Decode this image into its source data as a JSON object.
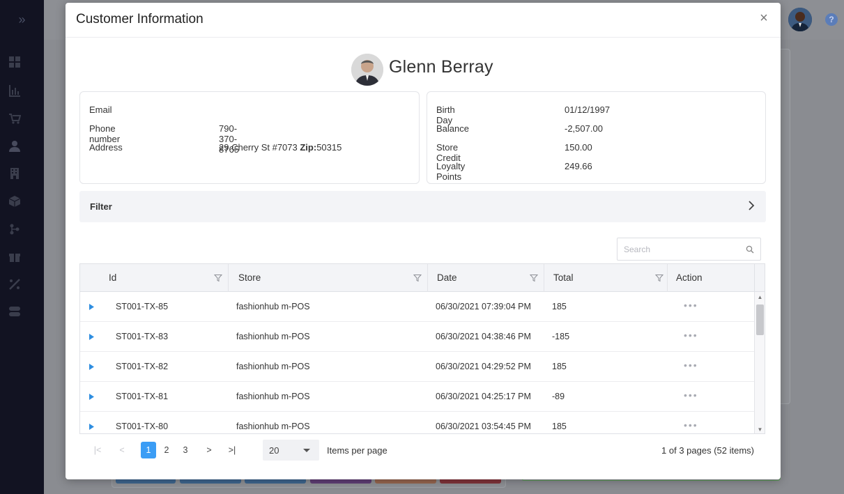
{
  "modal": {
    "title": "Customer Information",
    "close_glyph": "×"
  },
  "customer": {
    "name": "Glenn Berray",
    "left_fields": [
      {
        "label": "Email",
        "value": ""
      },
      {
        "label": "Phone number",
        "value": "790-370-8765"
      },
      {
        "label": "Address",
        "value": "29 Cherry St #7073",
        "zip_label": "Zip:",
        "zip_value": "50315"
      }
    ],
    "right_fields": [
      {
        "label": "Birth Day",
        "value": "01/12/1997"
      },
      {
        "label": "Balance",
        "value": "-2,507.00"
      },
      {
        "label": "Store Credit",
        "value": "150.00"
      },
      {
        "label": "Loyalty Points",
        "value": "249.66"
      }
    ]
  },
  "filter": {
    "label": "Filter"
  },
  "search": {
    "placeholder": "Search",
    "value": ""
  },
  "grid": {
    "columns": [
      "Id",
      "Store",
      "Date",
      "Total",
      "Action"
    ],
    "rows": [
      {
        "id": "ST001-TX-85",
        "store": "fashionhub m-POS",
        "date": "06/30/2021 07:39:04 PM",
        "total": "185",
        "action": "•••"
      },
      {
        "id": "ST001-TX-83",
        "store": "fashionhub m-POS",
        "date": "06/30/2021 04:38:46 PM",
        "total": "-185",
        "action": "•••"
      },
      {
        "id": "ST001-TX-82",
        "store": "fashionhub m-POS",
        "date": "06/30/2021 04:29:52 PM",
        "total": "185",
        "action": "•••"
      },
      {
        "id": "ST001-TX-81",
        "store": "fashionhub m-POS",
        "date": "06/30/2021 04:25:17 PM",
        "total": "-89",
        "action": "•••"
      },
      {
        "id": "ST001-TX-80",
        "store": "fashionhub m-POS",
        "date": "06/30/2021 03:54:45 PM",
        "total": "185",
        "action": "•••"
      }
    ]
  },
  "pager": {
    "first": "|<",
    "prev": "<",
    "pages": [
      "1",
      "2",
      "3"
    ],
    "current_page": "1",
    "next": ">",
    "last": ">|",
    "page_size": "20",
    "items_per_page_label": "Items per page",
    "info": "1 of 3 pages (52 items)"
  },
  "colors": {
    "accent": "#3b9df5",
    "sidebar": "#121322",
    "overlay": "#8a8c91"
  },
  "icons": {
    "rail": [
      "dashboard-icon",
      "chart-icon",
      "cart-icon",
      "user-icon",
      "building-icon",
      "box-icon",
      "hierarchy-icon",
      "gift-icon",
      "tag-icon",
      "toggle-icon"
    ],
    "header": [
      "close-icon"
    ],
    "filter": "chevron-right-icon",
    "search": "search-icon",
    "column": "filter-funnel-icon",
    "row": "expand-caret-icon"
  }
}
